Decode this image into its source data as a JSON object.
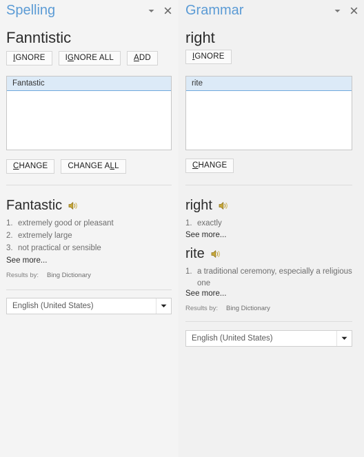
{
  "spelling": {
    "title": "Spelling",
    "titlebar": {
      "menu_icon": "chevron-down-icon",
      "close_icon": "close-icon"
    },
    "flagged_word": "Fanntistic",
    "actions": [
      {
        "label": "IGNORE",
        "accel_index": 0
      },
      {
        "label": "IGNORE ALL",
        "accel_index": 1
      },
      {
        "label": "ADD",
        "accel_index": 0
      }
    ],
    "suggestions": [
      {
        "text": "Fantastic",
        "selected": true
      }
    ],
    "change_actions": [
      {
        "label": "CHANGE",
        "accel_index": 0
      },
      {
        "label": "CHANGE ALL",
        "accel_index": 8
      }
    ],
    "definition": {
      "word": "Fantastic",
      "speaker_icon": "speaker-icon",
      "senses": [
        "extremely good or pleasant",
        "extremely large",
        "not practical or sensible"
      ],
      "see_more": "See more...",
      "results_by_label": "Results by:",
      "results_by_source": "Bing Dictionary"
    },
    "language": {
      "value": "English (United States)",
      "arrow_icon": "chevron-down-icon"
    }
  },
  "grammar": {
    "title": "Grammar",
    "titlebar": {
      "menu_icon": "chevron-down-icon",
      "close_icon": "close-icon"
    },
    "flagged_word": "right",
    "actions": [
      {
        "label": "IGNORE",
        "accel_index": 0
      }
    ],
    "suggestions": [
      {
        "text": "rite",
        "selected": true
      }
    ],
    "change_actions": [
      {
        "label": "CHANGE",
        "accel_index": 0
      }
    ],
    "definitions": [
      {
        "word": "right",
        "speaker_icon": "speaker-icon",
        "senses": [
          "exactly"
        ],
        "see_more": "See more..."
      },
      {
        "word": "rite",
        "speaker_icon": "speaker-icon",
        "senses": [
          "a traditional ceremony, especially a religious one"
        ],
        "see_more": "See more..."
      }
    ],
    "results_by_label": "Results by:",
    "results_by_source": "Bing Dictionary",
    "language": {
      "value": "English (United States)",
      "arrow_icon": "chevron-down-icon"
    }
  },
  "theme": {
    "accent": "#5b9bd5",
    "selection_bg": "#dceaf7",
    "selection_border": "#6fa8dc",
    "panel_bg": "#f4f4f4",
    "text": "#2b2b2b",
    "muted_text": "#6e6e6e"
  }
}
